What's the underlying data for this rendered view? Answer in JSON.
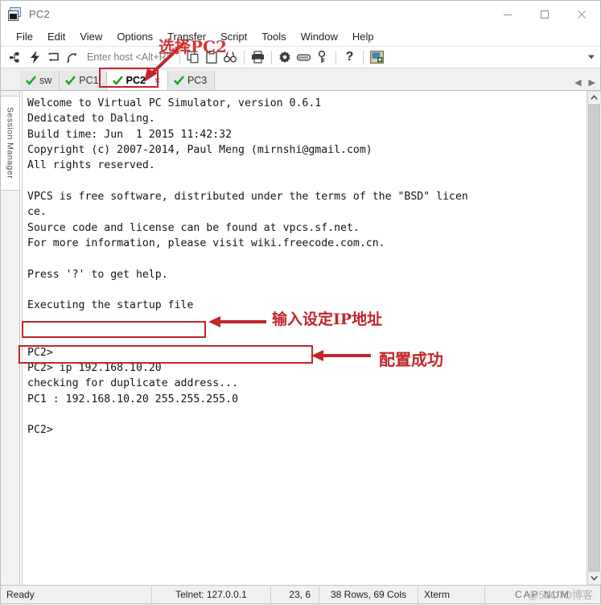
{
  "window": {
    "title": "PC2",
    "icon": "windows-stack-icon",
    "controls": {
      "minimize": "minimize-icon",
      "maximize": "maximize-icon",
      "close": "close-icon"
    }
  },
  "menubar": {
    "items": [
      "File",
      "Edit",
      "View",
      "Options",
      "Transfer",
      "Script",
      "Tools",
      "Window",
      "Help"
    ]
  },
  "toolbar": {
    "host_placeholder": "Enter host <Alt+R>",
    "icons": [
      "connect-icon",
      "quick-connect-icon",
      "reconnect-icon",
      "disconnect-icon",
      "copy-icon",
      "paste-icon",
      "find-icon",
      "print-icon",
      "settings-gear-icon",
      "keyboard-icon",
      "key-icon",
      "help-icon",
      "session-options-icon"
    ],
    "overflow": "toolbar-overflow-icon"
  },
  "tabs": {
    "items": [
      {
        "label": "sw",
        "active": false,
        "status": "connected"
      },
      {
        "label": "PC1",
        "active": false,
        "status": "connected"
      },
      {
        "label": "PC2",
        "active": true,
        "status": "connected",
        "close": "×"
      },
      {
        "label": "PC3",
        "active": false,
        "status": "connected"
      }
    ],
    "nav_prev": "◀",
    "nav_next": "▶"
  },
  "sidebar": {
    "label": "Session Manager"
  },
  "terminal": {
    "lines": [
      "Welcome to Virtual PC Simulator, version 0.6.1",
      "Dedicated to Daling.",
      "Build time: Jun  1 2015 11:42:32",
      "Copyright (c) 2007-2014, Paul Meng (mirnshi@gmail.com)",
      "All rights reserved.",
      "",
      "VPCS is free software, distributed under the terms of the \"BSD\" licen",
      "ce.",
      "Source code and license can be found at vpcs.sf.net.",
      "For more information, please visit wiki.freecode.com.cn.",
      "",
      "Press '?' to get help.",
      "",
      "Executing the startup file",
      "",
      "",
      "PC2>",
      "PC2> ip 192.168.10.20",
      "checking for duplicate address...",
      "PC1 : 192.168.10.20 255.255.255.0",
      "",
      "PC2>"
    ]
  },
  "statusbar": {
    "ready": "Ready",
    "connection": "Telnet: 127.0.0.1",
    "position": "23,  6",
    "size": "38 Rows, 69 Cols",
    "emulation": "Xterm",
    "indicators": "CAP NUM",
    "watermark": "@51CTO博客"
  },
  "annotations": {
    "color": "#c0262b",
    "select_pc2": "选择PC2",
    "enter_ip": "输入设定IP地址",
    "config_ok": "配置成功"
  }
}
